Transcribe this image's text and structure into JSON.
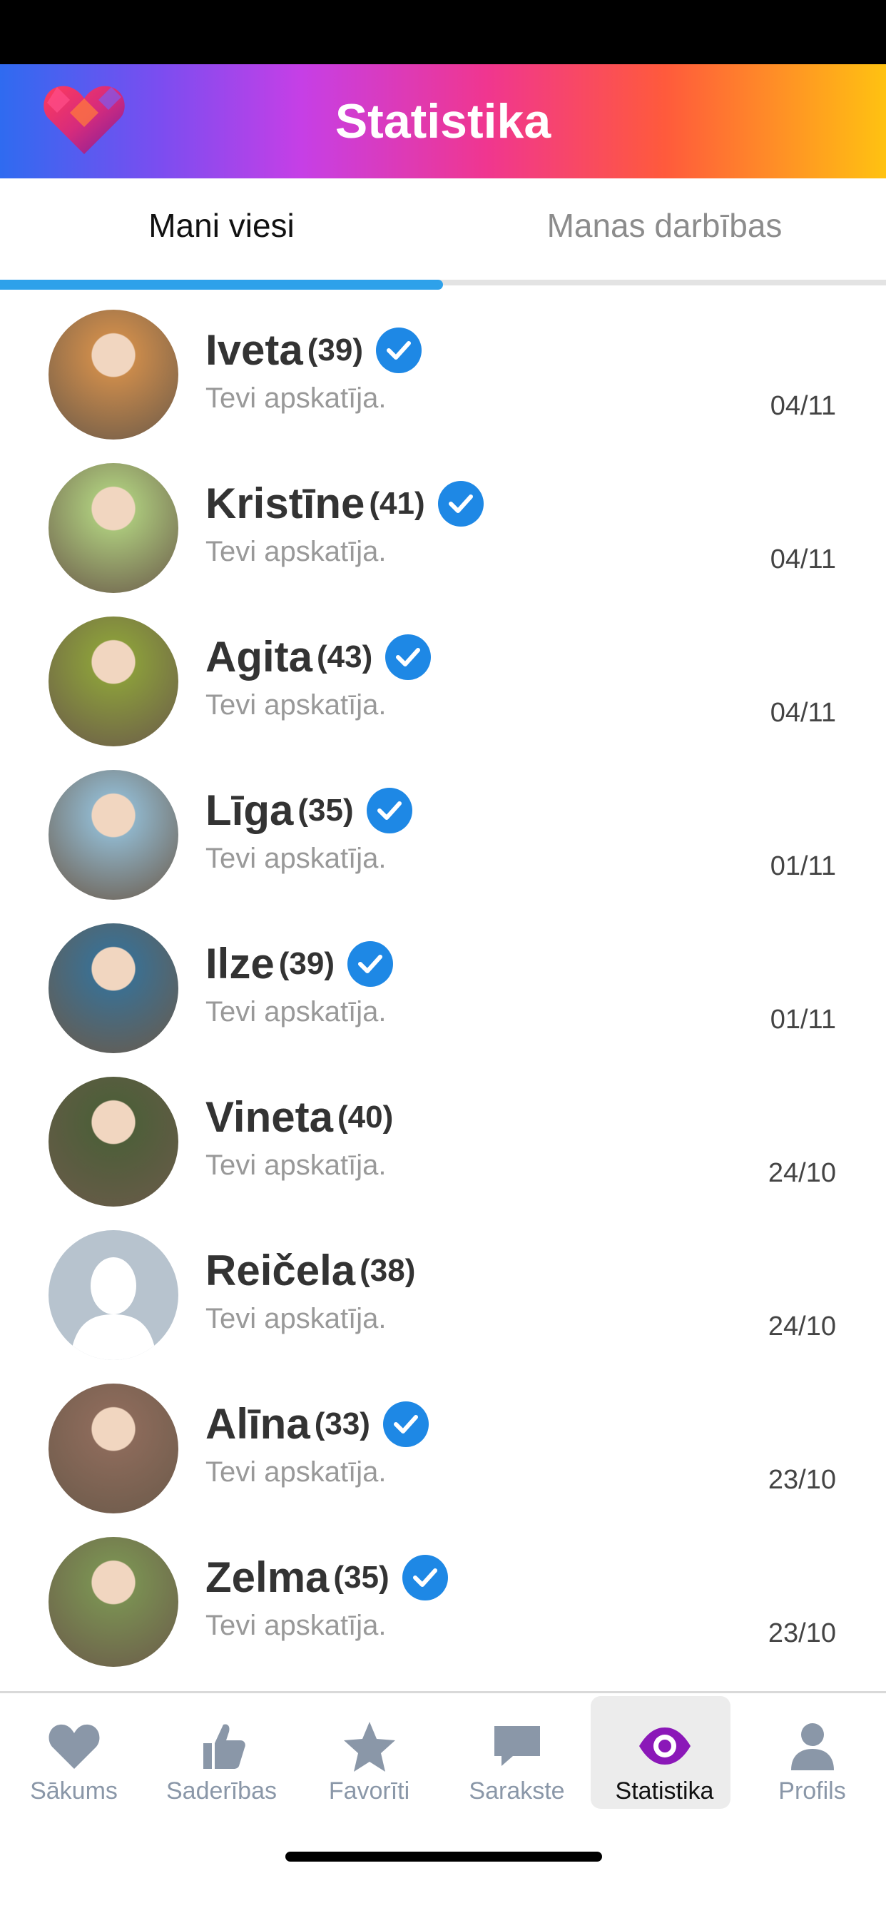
{
  "header": {
    "title": "Statistika"
  },
  "tabs": [
    {
      "label": "Mani viesi",
      "active": true
    },
    {
      "label": "Manas darbības",
      "active": false
    }
  ],
  "visitors": [
    {
      "name": "Iveta",
      "age": "(39)",
      "verified": true,
      "subtitle": "Tevi apskatīja.",
      "date": "04/11",
      "avatar_color": "#c98a4b"
    },
    {
      "name": "Kristīne",
      "age": "(41)",
      "verified": true,
      "subtitle": "Tevi apskatīja.",
      "date": "04/11",
      "avatar_color": "#a9c47a"
    },
    {
      "name": "Agita",
      "age": "(43)",
      "verified": true,
      "subtitle": "Tevi apskatīja.",
      "date": "04/11",
      "avatar_color": "#8a9b3c"
    },
    {
      "name": "Līga",
      "age": "(35)",
      "verified": true,
      "subtitle": "Tevi apskatīja.",
      "date": "01/11",
      "avatar_color": "#8fb3c7"
    },
    {
      "name": "Ilze",
      "age": "(39)",
      "verified": true,
      "subtitle": "Tevi apskatīja.",
      "date": "01/11",
      "avatar_color": "#3d6f8f"
    },
    {
      "name": "Vineta",
      "age": "(40)",
      "verified": false,
      "subtitle": "Tevi apskatīja.",
      "date": "24/10",
      "avatar_color": "#4f5e3a"
    },
    {
      "name": "Reičela",
      "age": "(38)",
      "verified": false,
      "subtitle": "Tevi apskatīja.",
      "date": "24/10",
      "avatar_color": "#b7c3ce"
    },
    {
      "name": "Alīna",
      "age": "(33)",
      "verified": true,
      "subtitle": "Tevi apskatīja.",
      "date": "23/10",
      "avatar_color": "#8b6a5a"
    },
    {
      "name": "Zelma",
      "age": "(35)",
      "verified": true,
      "subtitle": "Tevi apskatīja.",
      "date": "23/10",
      "avatar_color": "#7a8e52"
    }
  ],
  "bottom_nav": [
    {
      "label": "Sākums",
      "icon": "heart-icon",
      "active": false
    },
    {
      "label": "Saderības",
      "icon": "thumbs-up-icon",
      "active": false
    },
    {
      "label": "Favorīti",
      "icon": "star-icon",
      "active": false
    },
    {
      "label": "Sarakste",
      "icon": "chat-icon",
      "active": false
    },
    {
      "label": "Statistika",
      "icon": "eye-icon",
      "active": true
    },
    {
      "label": "Profils",
      "icon": "person-icon",
      "active": false
    }
  ],
  "colors": {
    "accent": "#2ea1ea",
    "verified": "#1e88e5",
    "nav_inactive": "#8a97a8",
    "nav_active_icon": "#8b18b8"
  }
}
